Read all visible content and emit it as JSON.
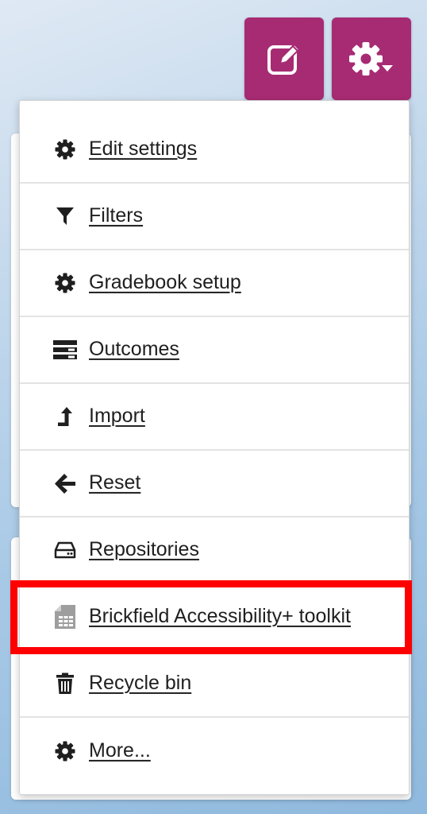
{
  "header": {
    "edit_button": {
      "icon": "edit-icon",
      "color": "#a72b73"
    },
    "settings_button": {
      "icon": "gear-dropdown-icon",
      "color": "#a72b73"
    }
  },
  "menu": {
    "items": [
      {
        "label": "Edit settings",
        "icon": "gear-icon"
      },
      {
        "label": "Filters",
        "icon": "filter-icon"
      },
      {
        "label": "Gradebook setup",
        "icon": "gear-icon"
      },
      {
        "label": "Outcomes",
        "icon": "outcomes-icon"
      },
      {
        "label": "Import",
        "icon": "import-icon"
      },
      {
        "label": "Reset",
        "icon": "arrow-left-icon"
      },
      {
        "label": "Repositories",
        "icon": "drive-icon"
      },
      {
        "label": "Brickfield Accessibility+ toolkit",
        "icon": "brickfield-icon",
        "highlighted": true
      },
      {
        "label": "Recycle bin",
        "icon": "trash-icon"
      },
      {
        "label": "More...",
        "icon": "gear-icon"
      }
    ]
  },
  "highlight_color": "#ff0000"
}
